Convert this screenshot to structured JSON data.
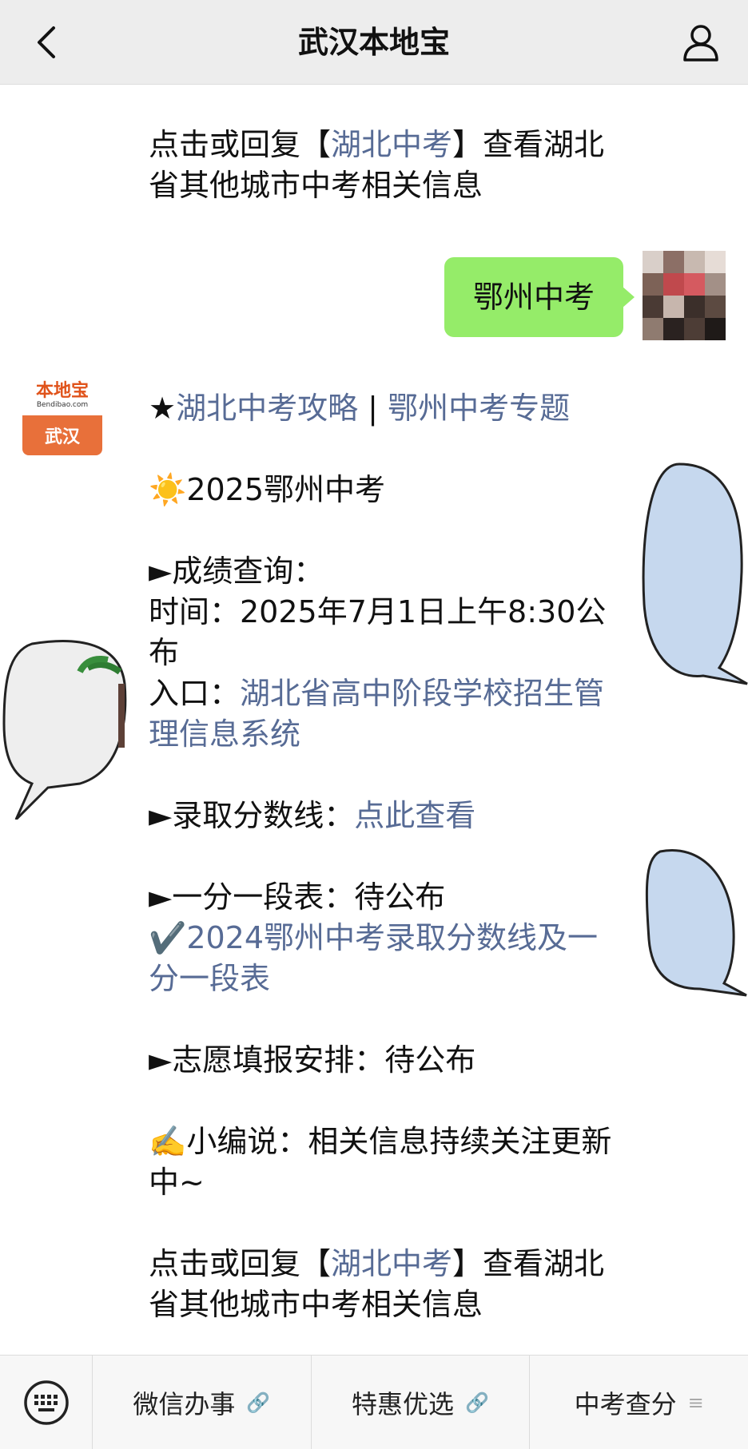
{
  "header": {
    "title": "武汉本地宝",
    "back_icon": "chevron-left-icon",
    "user_icon": "person-icon"
  },
  "chat": {
    "msg_top": {
      "p1": "点击或回复【",
      "link": "湖北中考",
      "p2": "】查看湖北省其他城市中考相关信息"
    },
    "user_message": "鄂州中考",
    "bot_avatar": {
      "brand": "本地宝",
      "sub": "Bendibao.com",
      "city": "武汉"
    },
    "reply": {
      "star": "★",
      "link1": "湖北中考攻略",
      "sep": " | ",
      "link2": "鄂州中考专题",
      "sun_icon": "☀️",
      "year_title": "2025鄂州中考",
      "score_head": "►成绩查询：",
      "time_line": "时间：2025年7月1日上午8:30公布",
      "entry_label": "入口：",
      "entry_link": "湖北省高中阶段学校招生管理信息系统",
      "cutoff_label": "►录取分数线：",
      "cutoff_link": "点此查看",
      "table_line": "►一分一段表：待公布",
      "check_icon": "✔️",
      "prev_link": "2024鄂州中考录取分数线及一分一段表",
      "volunteer_line": "►志愿填报安排：待公布",
      "editor_icon": "✍️",
      "editor_line": "小编说：相关信息持续关注更新中~",
      "end_p1": "点击或回复【",
      "end_link": "湖北中考",
      "end_p2": "】查看湖北省其他城市中考相关信息"
    }
  },
  "bottom_menu": {
    "keyboard_icon": "keyboard-icon",
    "items": [
      {
        "label": "微信办事",
        "icon": "link-icon"
      },
      {
        "label": "特惠优选",
        "icon": "link-icon"
      },
      {
        "label": "中考查分",
        "icon": "menu-lines-icon"
      }
    ]
  },
  "colors": {
    "link": "#576b95",
    "user_bubble": "#95ec69",
    "topbar": "#ededed"
  }
}
